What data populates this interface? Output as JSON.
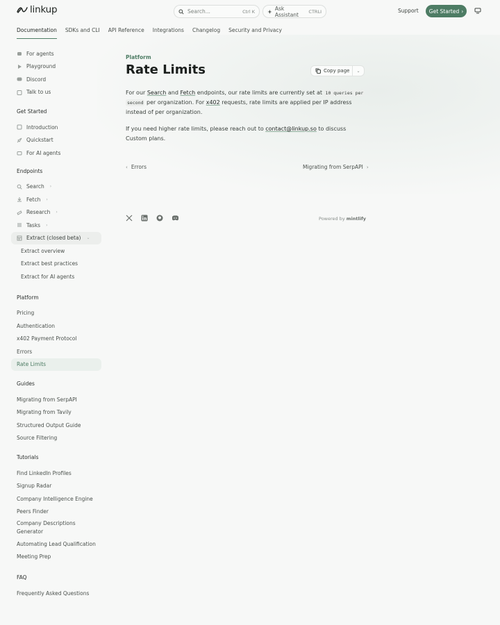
{
  "header": {
    "logo": "linkup",
    "search_placeholder": "Search...",
    "search_shortcut": "Ctrl K",
    "ask_label": "Ask Assistant",
    "ask_shortcut": "CTRLI",
    "support": "Support",
    "cta": "Get Started"
  },
  "nav_tabs": [
    "Documentation",
    "SDKs and CLI",
    "API Reference",
    "Integrations",
    "Changelog",
    "Security and Privacy"
  ],
  "sidebar": {
    "top": [
      "For agents",
      "Playground",
      "Discord",
      "Talk to us"
    ],
    "get_started": {
      "title": "Get Started",
      "items": [
        "Introduction",
        "Quickstart",
        "For AI agents"
      ]
    },
    "endpoints": {
      "title": "Endpoints",
      "items": [
        "Search",
        "Fetch",
        "Research",
        "Tasks",
        "Extract (closed beta)"
      ],
      "sub": [
        "Extract overview",
        "Extract best practices",
        "Extract for AI agents"
      ]
    },
    "platform": {
      "title": "Platform",
      "items": [
        "Pricing",
        "Authentication",
        "x402 Payment Protocol",
        "Errors",
        "Rate Limits"
      ]
    },
    "guides": {
      "title": "Guides",
      "items": [
        "Migrating from SerpAPI",
        "Migrating from Tavily",
        "Structured Output Guide",
        "Source Filtering"
      ]
    },
    "tutorials": {
      "title": "Tutorials",
      "items": [
        "Find LinkedIn Profiles",
        "Signup Radar",
        "Company Intelligence Engine",
        "Peers Finder",
        "Company Descriptions Generator",
        "Automating Lead Qualification",
        "Meeting Prep"
      ]
    },
    "faq": {
      "title": "FAQ",
      "items": [
        "Frequently Asked Questions"
      ]
    }
  },
  "main": {
    "breadcrumb": "Platform",
    "title": "Rate Limits",
    "copy_page": "Copy page",
    "p1": {
      "t1": "For our ",
      "link_search": "Search",
      "t2": " and ",
      "link_fetch": "Fetch",
      "t3": " endpoints, our rate limits are currently set at ",
      "code1": "10 queries per",
      "code2": "second",
      "t4": " per organization. For ",
      "link_x402": "x402",
      "t5": " requests, rate limits are applied per IP address instead of per organization."
    },
    "p2": {
      "t1": "If you need higher rate limits, please reach out to ",
      "link_email": "contact@linkup.so",
      "t2": " to discuss Custom plans."
    },
    "prev": "Errors",
    "next": "Migrating from SerpAPI",
    "powered_prefix": "Powered by",
    "powered_brand": "mintlify"
  },
  "colors": {
    "accent": "#4d7c64",
    "background": "#f7f8f7"
  }
}
